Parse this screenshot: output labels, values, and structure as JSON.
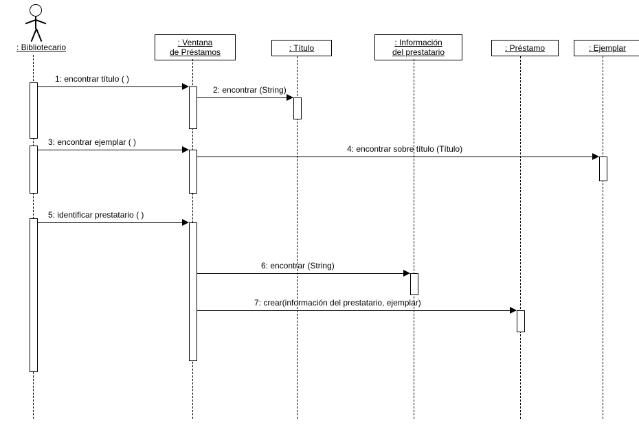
{
  "diagram_type": "UML Sequence Diagram",
  "actor": {
    "label": ": Bibliotecario"
  },
  "lifelines": {
    "ventana": {
      "label": ": Ventana\nde Préstamos"
    },
    "titulo": {
      "label": ": Título"
    },
    "info": {
      "label": ": Información\ndel prestatario"
    },
    "prestamo": {
      "label": ": Préstamo"
    },
    "ejemplar": {
      "label": ": Ejemplar"
    }
  },
  "messages": {
    "m1": {
      "label": "1: encontrar título ( )"
    },
    "m2": {
      "label": "2: encontrar  (String)"
    },
    "m3": {
      "label": "3: encontrar ejemplar ( )"
    },
    "m4": {
      "label": "4: encontrar sobre título (Título)"
    },
    "m5": {
      "label": "5: identificar prestatario ( )"
    },
    "m6": {
      "label": "6: encontrar (String)"
    },
    "m7": {
      "label": "7: crear(información del prestatario, ejemplar)"
    }
  },
  "chart_data": {
    "type": "sequence-diagram",
    "participants": [
      {
        "id": "bibliotecario",
        "name": ": Bibliotecario",
        "kind": "actor"
      },
      {
        "id": "ventana",
        "name": ": Ventana de Préstamos",
        "kind": "object"
      },
      {
        "id": "titulo",
        "name": ": Título",
        "kind": "object"
      },
      {
        "id": "info",
        "name": ": Información del prestatario",
        "kind": "object"
      },
      {
        "id": "prestamo",
        "name": ": Préstamo",
        "kind": "object"
      },
      {
        "id": "ejemplar",
        "name": ": Ejemplar",
        "kind": "object"
      }
    ],
    "messages": [
      {
        "seq": 1,
        "from": "bibliotecario",
        "to": "ventana",
        "label": "encontrar título ( )"
      },
      {
        "seq": 2,
        "from": "ventana",
        "to": "titulo",
        "label": "encontrar  (String)"
      },
      {
        "seq": 3,
        "from": "bibliotecario",
        "to": "ventana",
        "label": "encontrar ejemplar ( )"
      },
      {
        "seq": 4,
        "from": "ventana",
        "to": "ejemplar",
        "label": "encontrar sobre título (Título)"
      },
      {
        "seq": 5,
        "from": "bibliotecario",
        "to": "ventana",
        "label": "identificar prestatario ( )"
      },
      {
        "seq": 6,
        "from": "ventana",
        "to": "info",
        "label": "encontrar (String)"
      },
      {
        "seq": 7,
        "from": "ventana",
        "to": "prestamo",
        "label": "crear(información del prestatario, ejemplar)"
      }
    ]
  }
}
